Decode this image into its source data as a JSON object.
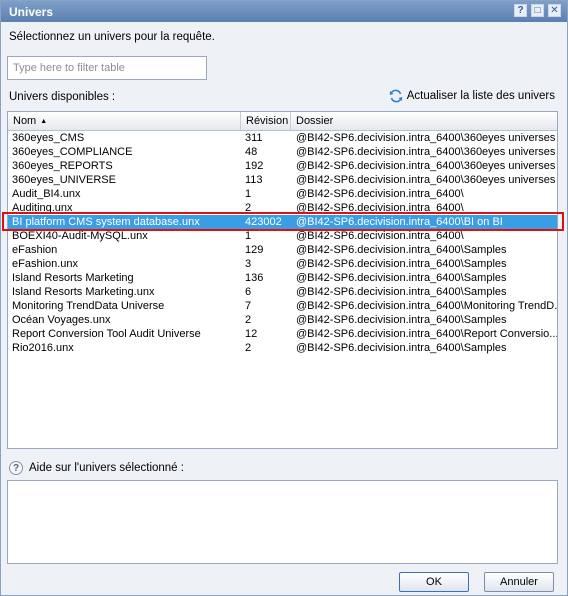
{
  "window": {
    "title": "Univers",
    "controls": [
      {
        "name": "help-icon",
        "glyph": "?"
      },
      {
        "name": "maximize-icon",
        "glyph": "□"
      },
      {
        "name": "close-icon",
        "glyph": "✕"
      }
    ]
  },
  "prompt": "Sélectionnez un univers pour la requête.",
  "filter": {
    "placeholder": "Type here to filter table",
    "value": ""
  },
  "available_label": "Univers disponibles :",
  "refresh": {
    "label": "Actualiser la liste des univers",
    "icon": "refresh-icon"
  },
  "table": {
    "columns": {
      "name": "Nom",
      "revision": "Révision",
      "folder": "Dossier"
    },
    "sort": {
      "column": "name",
      "direction": "ascending"
    },
    "rows": [
      {
        "name": "360eyes_CMS",
        "revision": "311",
        "folder": "@BI42-SP6.decivision.intra_6400\\360eyes universes"
      },
      {
        "name": "360eyes_COMPLIANCE",
        "revision": "48",
        "folder": "@BI42-SP6.decivision.intra_6400\\360eyes universes"
      },
      {
        "name": "360eyes_REPORTS",
        "revision": "192",
        "folder": "@BI42-SP6.decivision.intra_6400\\360eyes universes"
      },
      {
        "name": "360eyes_UNIVERSE",
        "revision": "113",
        "folder": "@BI42-SP6.decivision.intra_6400\\360eyes universes"
      },
      {
        "name": "Audit_BI4.unx",
        "revision": "1",
        "folder": "@BI42-SP6.decivision.intra_6400\\"
      },
      {
        "name": "Auditing.unx",
        "revision": "2",
        "folder": "@BI42-SP6.decivision.intra_6400\\"
      },
      {
        "name": "BI platform CMS system database.unx",
        "revision": "423002",
        "folder": "@BI42-SP6.decivision.intra_6400\\BI on BI",
        "selected": true
      },
      {
        "name": "BOEXI40-Audit-MySQL.unx",
        "revision": "1",
        "folder": "@BI42-SP6.decivision.intra_6400\\"
      },
      {
        "name": "eFashion",
        "revision": "129",
        "folder": "@BI42-SP6.decivision.intra_6400\\Samples"
      },
      {
        "name": "eFashion.unx",
        "revision": "3",
        "folder": "@BI42-SP6.decivision.intra_6400\\Samples"
      },
      {
        "name": "Island Resorts Marketing",
        "revision": "136",
        "folder": "@BI42-SP6.decivision.intra_6400\\Samples"
      },
      {
        "name": "Island Resorts Marketing.unx",
        "revision": "6",
        "folder": "@BI42-SP6.decivision.intra_6400\\Samples"
      },
      {
        "name": "Monitoring TrendData Universe",
        "revision": "7",
        "folder": "@BI42-SP6.decivision.intra_6400\\Monitoring TrendD..."
      },
      {
        "name": "Océan Voyages.unx",
        "revision": "2",
        "folder": "@BI42-SP6.decivision.intra_6400\\Samples"
      },
      {
        "name": "Report Conversion Tool Audit Universe",
        "revision": "12",
        "folder": "@BI42-SP6.decivision.intra_6400\\Report Conversio..."
      },
      {
        "name": "Rio2016.unx",
        "revision": "2",
        "folder": "@BI42-SP6.decivision.intra_6400\\Samples"
      }
    ]
  },
  "help": {
    "label": "Aide sur l'univers sélectionné :",
    "icon": "help-icon",
    "content": ""
  },
  "buttons": {
    "ok": "OK",
    "cancel": "Annuler"
  },
  "colors": {
    "selection": "#3a9ee5",
    "highlight_border": "#e01010",
    "titlebar": "#5b7fb0"
  }
}
